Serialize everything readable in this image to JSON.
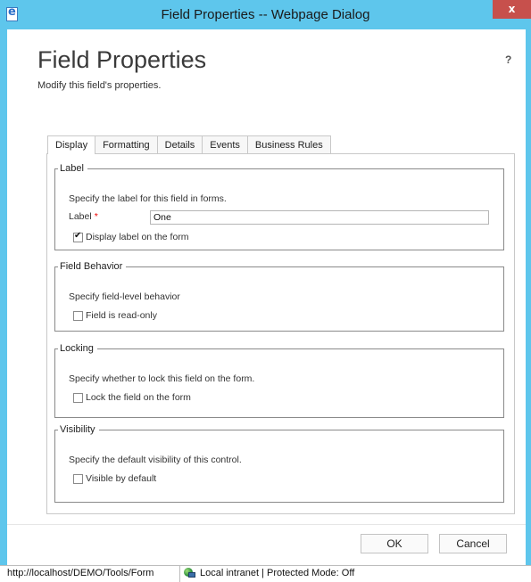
{
  "window": {
    "title": "Field Properties -- Webpage Dialog",
    "close_glyph": "x"
  },
  "header": {
    "title": "Field Properties",
    "subtitle": "Modify this field's properties.",
    "help": "?"
  },
  "tabs": [
    {
      "label": "Display",
      "active": true
    },
    {
      "label": "Formatting",
      "active": false
    },
    {
      "label": "Details",
      "active": false
    },
    {
      "label": "Events",
      "active": false
    },
    {
      "label": "Business Rules",
      "active": false
    }
  ],
  "groups": {
    "label": {
      "legend": "Label",
      "description": "Specify the label for this field in forms.",
      "field_label": "Label",
      "required_mark": "*",
      "value": "One",
      "checkbox_label": "Display label on the form",
      "checkbox_checked": true
    },
    "behavior": {
      "legend": "Field Behavior",
      "description": "Specify field-level behavior",
      "checkbox_label": "Field is read-only",
      "checkbox_checked": false
    },
    "locking": {
      "legend": "Locking",
      "description": "Specify whether to lock this field on the form.",
      "checkbox_label": "Lock the field on the form",
      "checkbox_checked": false
    },
    "visibility": {
      "legend": "Visibility",
      "description": "Specify the default visibility of this control.",
      "checkbox_label": "Visible by default",
      "checkbox_checked": false
    }
  },
  "footer": {
    "ok_label": "OK",
    "cancel_label": "Cancel"
  },
  "statusbar": {
    "url": "http://localhost/DEMO/Tools/Form",
    "zone": "Local intranet | Protected Mode: Off",
    "zone_icon": "intranet-globe-icon"
  },
  "colors": {
    "frame": "#5ec6ec",
    "close": "#c7504c",
    "required": "#ee0000"
  }
}
